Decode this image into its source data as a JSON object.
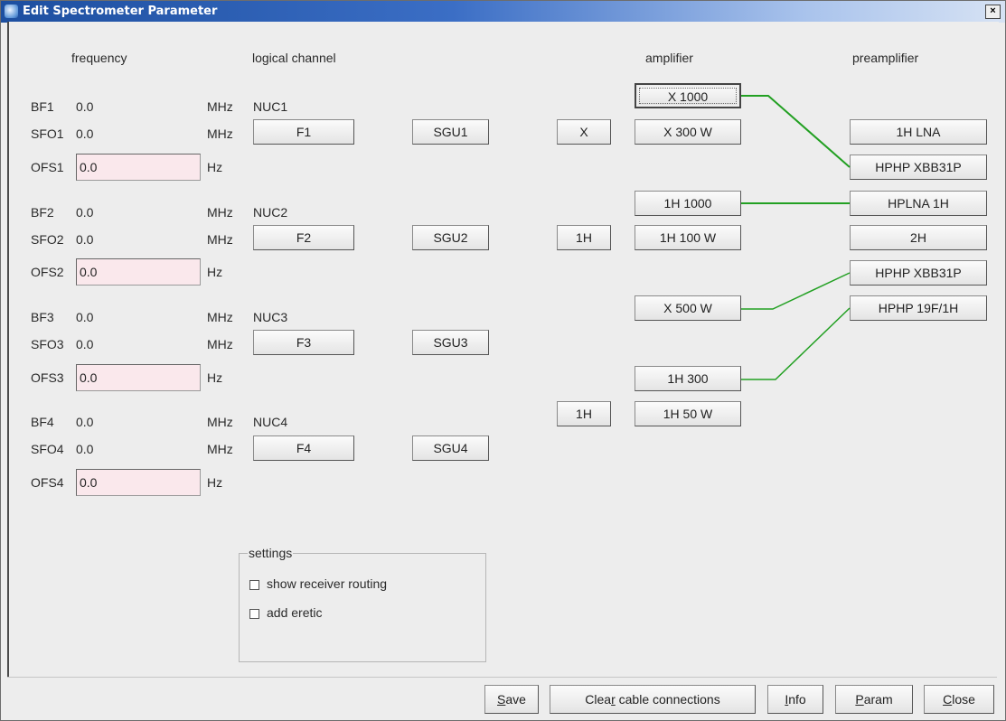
{
  "window": {
    "title": "Edit Spectrometer Parameter",
    "close_glyph": "×"
  },
  "headers": {
    "frequency": "frequency",
    "logical_channel": "logical channel",
    "amplifier": "amplifier",
    "preamplifier": "preamplifier"
  },
  "channels": [
    {
      "bf_label": "BF1",
      "bf_value": "0.0",
      "sfo_label": "SFO1",
      "sfo_value": "0.0",
      "ofs_label": "OFS1",
      "ofs_value": "0.0",
      "nuc": "NUC1",
      "f_button": "F1",
      "sgu_button": "SGU1"
    },
    {
      "bf_label": "BF2",
      "bf_value": "0.0",
      "sfo_label": "SFO2",
      "sfo_value": "0.0",
      "ofs_label": "OFS2",
      "ofs_value": "0.0",
      "nuc": "NUC2",
      "f_button": "F2",
      "sgu_button": "SGU2"
    },
    {
      "bf_label": "BF3",
      "bf_value": "0.0",
      "sfo_label": "SFO3",
      "sfo_value": "0.0",
      "ofs_label": "OFS3",
      "ofs_value": "0.0",
      "nuc": "NUC3",
      "f_button": "F3",
      "sgu_button": "SGU3"
    },
    {
      "bf_label": "BF4",
      "bf_value": "0.0",
      "sfo_label": "SFO4",
      "sfo_value": "0.0",
      "ofs_label": "OFS4",
      "ofs_value": "0.0",
      "nuc": "NUC4",
      "f_button": "F4",
      "sgu_button": "SGU4"
    }
  ],
  "units": {
    "mhz": "MHz",
    "hz": "Hz"
  },
  "router_buttons": [
    "X",
    "1H",
    "1H"
  ],
  "amplifiers": [
    "X 1000",
    "X 300 W",
    "1H 1000",
    "1H 100 W",
    "X 500 W",
    "1H 300",
    "1H 50 W"
  ],
  "preamplifiers": [
    "1H LNA",
    "HPHP XBB31P",
    "HPLNA 1H",
    "2H",
    "HPHP XBB31P",
    "HPHP 19F/1H"
  ],
  "settings": {
    "legend": "settings",
    "show_receiver_routing": "show receiver routing",
    "add_eretic": "add eretic"
  },
  "bottom_buttons": {
    "save": {
      "before": "",
      "accel": "S",
      "after": "ave"
    },
    "clear": {
      "before": "Clea",
      "accel": "r",
      "after": " cable connections"
    },
    "info": {
      "before": "",
      "accel": "I",
      "after": "nfo"
    },
    "param": {
      "before": "",
      "accel": "P",
      "after": "aram"
    },
    "close": {
      "before": "",
      "accel": "C",
      "after": "lose"
    }
  },
  "colors": {
    "cable": "#22a022",
    "ofs_field_bg": "#fae8ec"
  }
}
